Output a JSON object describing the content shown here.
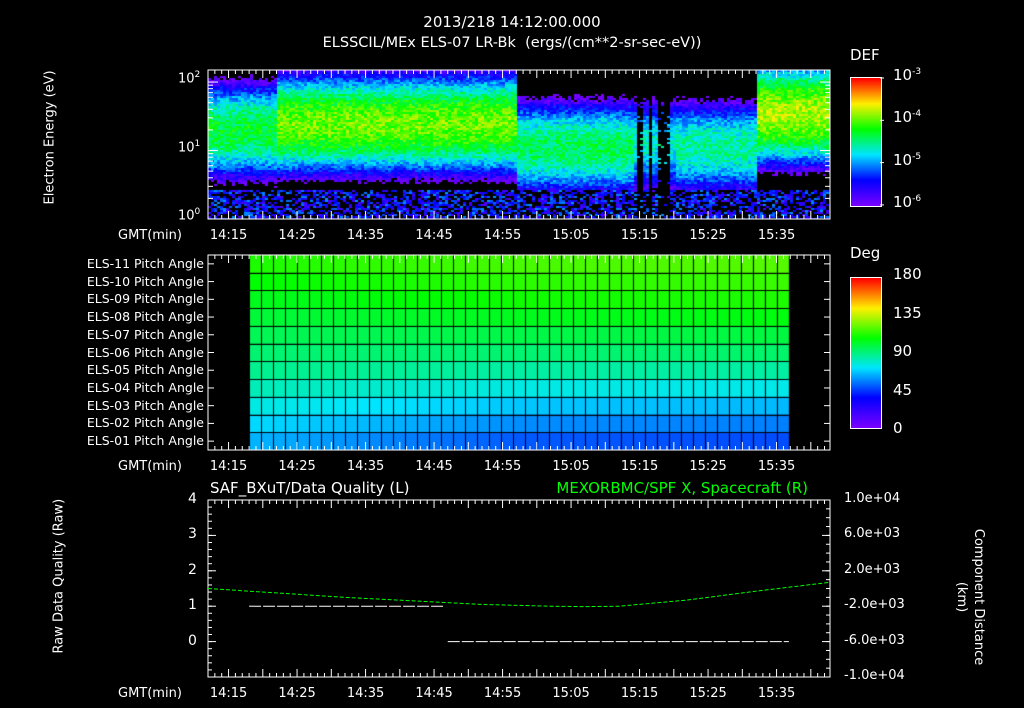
{
  "header": {
    "timestamp": "2013/218 14:12:00.000",
    "subtitle": "ELSSCIL/MEx ELS-07 LR-Bk  (ergs/(cm**2-sr-sec-eV))"
  },
  "time_axis": {
    "label": "GMT(min)",
    "start_min": 12,
    "end_min": 102.8,
    "ticks": [
      {
        "t": 15,
        "label": "14:15"
      },
      {
        "t": 25,
        "label": "14:25"
      },
      {
        "t": 35,
        "label": "14:35"
      },
      {
        "t": 45,
        "label": "14:45"
      },
      {
        "t": 55,
        "label": "14:55"
      },
      {
        "t": 65,
        "label": "15:05"
      },
      {
        "t": 75,
        "label": "15:15"
      },
      {
        "t": 85,
        "label": "15:25"
      },
      {
        "t": 95,
        "label": "15:35"
      }
    ]
  },
  "chart_data": [
    {
      "type": "heatmap",
      "name": "electron-spectrogram",
      "ylabel": "Electron Energy (eV)",
      "yscale": "log",
      "ylim": [
        1,
        150
      ],
      "yticks": [
        {
          "v": 1,
          "base": "10",
          "exp": "0"
        },
        {
          "v": 10,
          "base": "10",
          "exp": "1"
        },
        {
          "v": 100,
          "base": "10",
          "exp": "2"
        }
      ],
      "colorbar": {
        "title": "DEF",
        "range_log10": [
          -6,
          -3
        ],
        "ticks": [
          {
            "base": "10",
            "exp": "-3"
          },
          {
            "base": "10",
            "exp": "-4"
          },
          {
            "base": "10",
            "exp": "-5"
          },
          {
            "base": "10",
            "exp": "-6"
          }
        ]
      },
      "profile": [
        {
          "t0": 12,
          "t1": 22,
          "peak_log_eV": 1.3,
          "peak_log_def": -4.3
        },
        {
          "t0": 22,
          "t1": 57,
          "peak_log_eV": 1.4,
          "peak_log_def": -3.95
        },
        {
          "t0": 57,
          "t1": 74,
          "peak_log_eV": 1.05,
          "peak_log_def": -4.4
        },
        {
          "t0": 74,
          "t1": 80,
          "peak_log_eV": 1.1,
          "peak_log_def": -4.7
        },
        {
          "t0": 80,
          "t1": 92,
          "peak_log_eV": 1.05,
          "peak_log_def": -4.55
        },
        {
          "t0": 92,
          "t1": 102.8,
          "peak_log_eV": 1.55,
          "peak_log_def": -3.8
        }
      ],
      "dropouts": [
        [
          74.2,
          75.4
        ],
        [
          76.3,
          76.7
        ],
        [
          77.6,
          79.4
        ]
      ]
    },
    {
      "type": "heatmap",
      "name": "pitch-angle-grid",
      "colorbar": {
        "title": "Deg",
        "range": [
          0,
          180
        ],
        "ticks": [
          "180",
          "135",
          "90",
          "45",
          "0"
        ]
      },
      "rows": [
        "ELS-11 Pitch Angle",
        "ELS-10 Pitch Angle",
        "ELS-09 Pitch Angle",
        "ELS-08 Pitch Angle",
        "ELS-07 Pitch Angle",
        "ELS-06 Pitch Angle",
        "ELS-05 Pitch Angle",
        "ELS-04 Pitch Angle",
        "ELS-03 Pitch Angle",
        "ELS-02 Pitch Angle",
        "ELS-01 Pitch Angle"
      ],
      "t_range": [
        18,
        96.8
      ],
      "columns": 45,
      "angle_start_deg": [
        112,
        108,
        104,
        100,
        96,
        92,
        88,
        82,
        76,
        70,
        64
      ],
      "angle_mid_deg": [
        118,
        114,
        110,
        104,
        98,
        92,
        85,
        76,
        67,
        58,
        50
      ],
      "angle_end_deg": [
        120,
        116,
        112,
        106,
        99,
        93,
        85,
        75,
        65,
        56,
        48
      ]
    },
    {
      "type": "line",
      "name": "quality-and-position",
      "left_title": "SAF_BXuT/Data Quality (L)",
      "right_title": "MEXORBMC/SPF X, Spacecraft (R)",
      "ylabel_left": "Raw Data Quality (Raw)",
      "ylabel_right": "Component Distance (km)",
      "ylim_left": [
        -1,
        4
      ],
      "yticks_left": [
        "4",
        "3",
        "2",
        "1",
        "0"
      ],
      "ylim_right": [
        -10000,
        10000
      ],
      "yticks_right": [
        "1.0e+04",
        "6.0e+03",
        "2.0e+03",
        "-2.0e+03",
        "-6.0e+03",
        "-1.0e+04"
      ],
      "series": [
        {
          "name": "Data Quality",
          "color": "#ffffff",
          "segments": [
            {
              "t": [
                18,
                46.5
              ],
              "value": 1
            },
            {
              "t": [
                47,
                96.8
              ],
              "value": 0
            }
          ]
        },
        {
          "name": "SPF X",
          "color": "#00ff00",
          "t": [
            12,
            22,
            32,
            42,
            52,
            62,
            67,
            72,
            82,
            92,
            102.8
          ],
          "value": [
            0,
            -500,
            -1000,
            -1400,
            -1800,
            -2000,
            -2050,
            -2000,
            -1300,
            -300,
            700
          ]
        }
      ]
    }
  ]
}
